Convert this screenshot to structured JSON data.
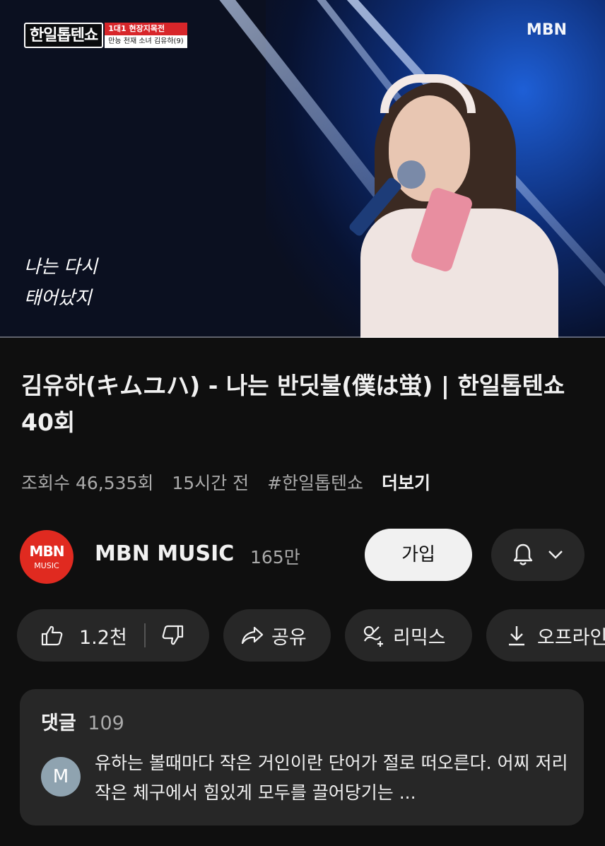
{
  "video": {
    "show_logo": "한일톱텐쇼",
    "badge_top": "1대1 현장지목전",
    "badge_bottom": "만능 천재 소녀 김유하(9)",
    "broadcaster": "MBN",
    "lyric_line1": "나는 다시",
    "lyric_line2": "태어났지"
  },
  "title": "김유하(キムユハ) - 나는 반딧불(僕は蛍) | 한일톱텐쇼 40회",
  "meta": {
    "views": "조회수 46,535회",
    "time": "15시간 전",
    "hashtag": "#한일톱텐쇼",
    "more": "더보기"
  },
  "channel": {
    "avatar_top": "MBN",
    "avatar_bottom": "MUSIC",
    "name": "MBN MUSIC",
    "subscribers": "165만",
    "join_label": "가입"
  },
  "actions": {
    "likes": "1.2천",
    "share": "공유",
    "remix": "리믹스",
    "offline": "오프라인"
  },
  "comments": {
    "label": "댓글",
    "count": "109",
    "avatar_letter": "M",
    "top_comment": "유하는 볼때마다 작은 거인이란 단어가 절로 떠오른다. 어찌 저리 작은 체구에서 힘있게 모두를 끌어당기는 ..."
  },
  "colors": {
    "background": "#0f0f0f",
    "pill": "#272727",
    "brand_red": "#e02a20"
  }
}
